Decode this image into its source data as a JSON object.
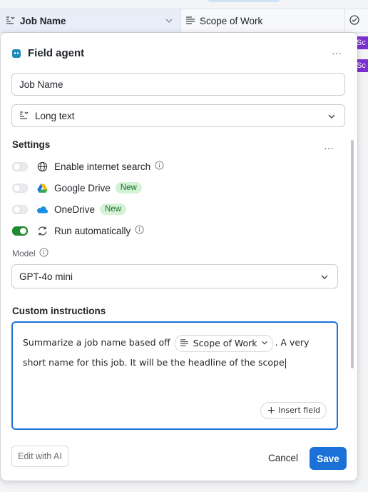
{
  "grid": {
    "columns": [
      {
        "name": "Job Name"
      },
      {
        "name": "Scope of Work"
      }
    ],
    "row_pill_text": "Sc"
  },
  "panel": {
    "title": "Field agent",
    "field_name_value": "Job Name",
    "field_type": "Long text",
    "settings_title": "Settings",
    "settings": [
      {
        "label": "Enable internet search",
        "enabled": false,
        "icon": "globe-icon"
      },
      {
        "label": "Google Drive",
        "enabled": false,
        "badge": "New",
        "icon": "google-drive-icon"
      },
      {
        "label": "OneDrive",
        "enabled": false,
        "badge": "New",
        "icon": "onedrive-icon"
      },
      {
        "label": "Run automatically",
        "enabled": true,
        "icon": "refresh-icon"
      }
    ],
    "model_label": "Model",
    "model_value": "GPT-4o mini",
    "custom_instructions_title": "Custom instructions",
    "instructions": {
      "before": "Summarize a job name based off",
      "chip": "Scope of Work",
      "after": ". A very short name for this job. It will be the headline of the scope"
    },
    "insert_field_label": "Insert field",
    "edit_with_ai_label": "Edit with AI",
    "cancel_label": "Cancel",
    "save_label": "Save"
  },
  "colors": {
    "accent": "#1b71d8",
    "toggle_on": "#1f8a2f",
    "badge_bg": "#d4f3d6",
    "agent_icon": "#1b8ab8"
  }
}
